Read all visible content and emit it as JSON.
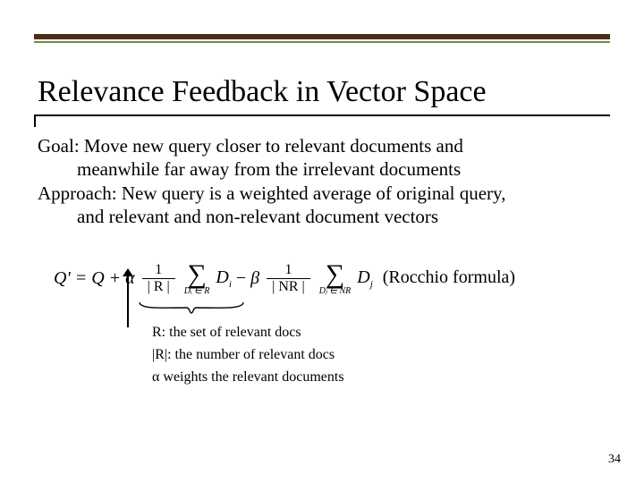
{
  "title": "Relevance Feedback in Vector Space",
  "body": {
    "l1": "Goal: Move new query closer to relevant documents and",
    "l2": "meanwhile far away from the irrelevant documents",
    "l3": "Approach: New query is a weighted average of original query,",
    "l4": "and relevant and non-relevant document vectors"
  },
  "formula": {
    "lhs": "Q' = Q + ",
    "alpha": "α",
    "frac1_num": "1",
    "frac1_den": "| R |",
    "sum1_sub": "Dᵢ ∈ R",
    "di": "D",
    "di_sub": "i",
    "minus": " − ",
    "beta": "β",
    "frac2_num": "1",
    "frac2_den": "| NR |",
    "sum2_sub": "Dⱼ ∈ NR",
    "dj": "D",
    "dj_sub": "j",
    "name": "(Rocchio formula)"
  },
  "annotations": {
    "a1": "R: the set of relevant docs",
    "a2": "|R|: the number of relevant docs",
    "a3": "α weights the relevant documents"
  },
  "page": "34"
}
